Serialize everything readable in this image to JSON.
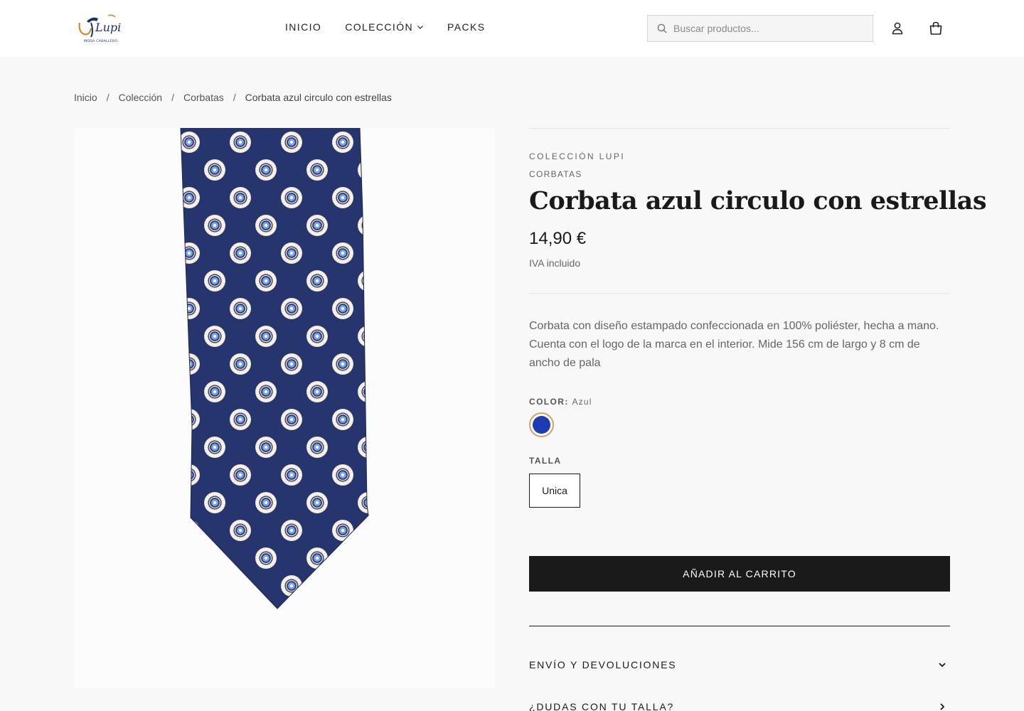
{
  "header": {
    "logo_text": "Lupi",
    "logo_subtitle": "MODA CABALLERO",
    "nav": [
      {
        "label": "INICIO"
      },
      {
        "label": "COLECCIÓN"
      },
      {
        "label": "PACKS"
      }
    ],
    "search_placeholder": "Buscar productos...",
    "icons": [
      "search-icon",
      "user-icon",
      "shopping-bag-icon",
      "chevron-down-icon"
    ]
  },
  "breadcrumb": {
    "items": [
      "Inicio",
      "Colección",
      "Corbatas"
    ],
    "separator": "/",
    "current": "Corbata azul circulo con estrellas"
  },
  "product": {
    "vendor": "COLECCIÓN LUPI",
    "category": "CORBATAS",
    "title": "Corbata azul circulo con estrellas",
    "price": "14,90 €",
    "tax_note": "IVA incluido",
    "description": "Corbata con diseño estampado confeccionada en 100% poliéster, hecha a mano. Cuenta con el logo de la marca en el interior. Mide 156 cm de largo y 8 cm de ancho de pala",
    "color_label": "COLOR:",
    "color_value": "Azul",
    "swatch_color": "#1f3bb3",
    "size_label": "TALLA",
    "size_options": [
      "Unica"
    ],
    "add_to_cart": "AÑADIR AL CARRITO",
    "accordions": [
      {
        "label": "ENVÍO Y DEVOLUCIONES",
        "icon": "chevron-down-icon"
      },
      {
        "label": "¿DUDAS CON TU TALLA?",
        "icon": "chevron-right-icon"
      }
    ]
  },
  "colors": {
    "header_bg": "#ffffff",
    "page_bg": "#f8f8f8",
    "button_bg": "#1a1a1a",
    "swatch_ring": "#c8a66a",
    "tie_navy": "#27356f"
  }
}
